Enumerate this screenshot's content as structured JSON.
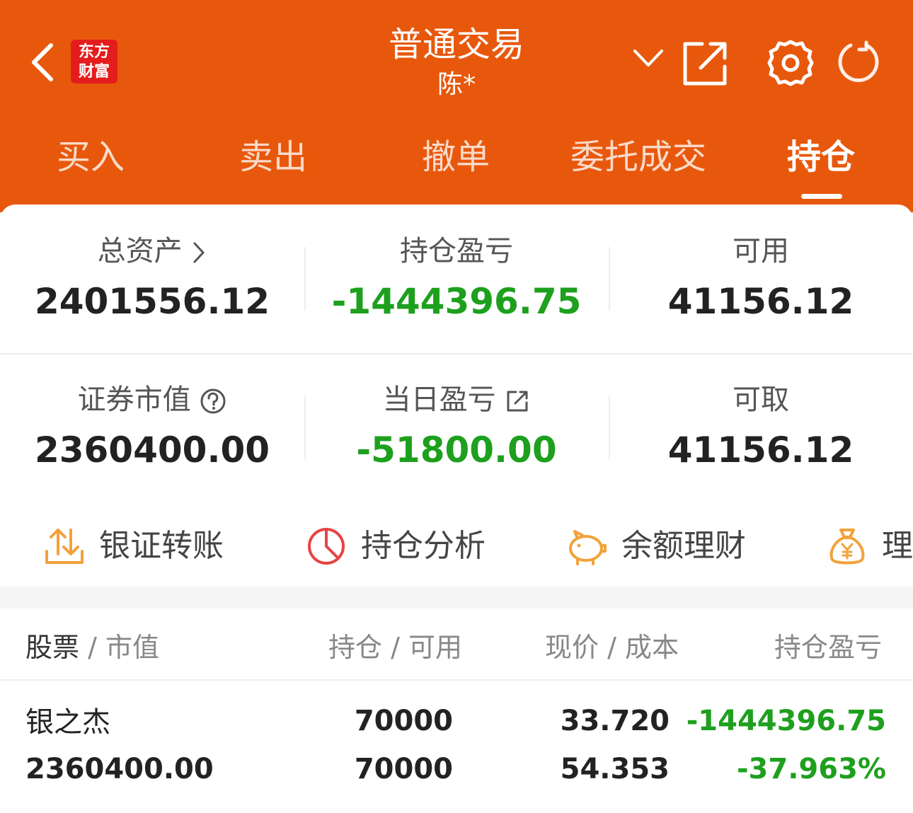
{
  "header": {
    "logo_line1": "东方",
    "logo_line2": "财富",
    "title": "普通交易",
    "account": "陈*",
    "bg_color": "#e8580c"
  },
  "tabs": [
    "买入",
    "卖出",
    "撤单",
    "委托成交",
    "持仓"
  ],
  "active_tab": "持仓",
  "summary": {
    "total_assets_label": "总资产",
    "total_assets": "2401556.12",
    "position_pl_label": "持仓盈亏",
    "position_pl": "-1444396.75",
    "available_label": "可用",
    "available": "41156.12",
    "market_value_label": "证券市值",
    "market_value": "2360400.00",
    "daily_pl_label": "当日盈亏",
    "daily_pl": "-51800.00",
    "withdrawable_label": "可取",
    "withdrawable": "41156.12"
  },
  "shortcuts": [
    "银证转账",
    "持仓分析",
    "余额理财",
    "理"
  ],
  "table": {
    "headers": {
      "stock": "股票",
      "market_value": "市值",
      "position": "持仓",
      "available": "可用",
      "price": "现价",
      "cost": "成本",
      "pl": "持仓盈亏"
    },
    "rows": [
      {
        "name": "银之杰",
        "market_value": "2360400.00",
        "position": "70000",
        "available": "70000",
        "price": "33.720",
        "cost": "54.353",
        "pl": "-1444396.75",
        "pl_pct": "-37.963%"
      }
    ]
  },
  "colors": {
    "loss_green": "#1ea01e",
    "accent_orange": "#e8580c",
    "icon_orange": "#f2a23a",
    "icon_red": "#e64545"
  }
}
